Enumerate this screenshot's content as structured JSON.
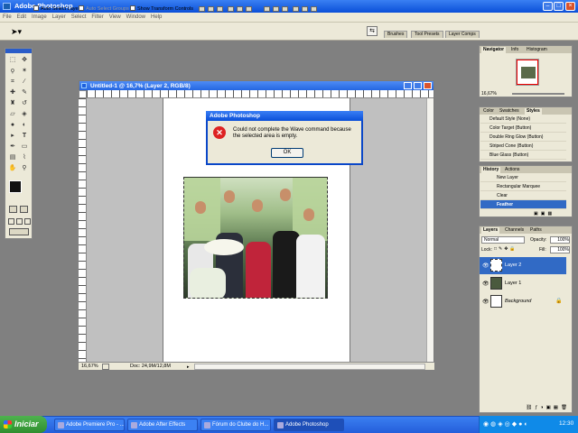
{
  "window": {
    "title": "Adobe Photoshop"
  },
  "menu": [
    "File",
    "Edit",
    "Image",
    "Layer",
    "Select",
    "Filter",
    "View",
    "Window",
    "Help"
  ],
  "options": {
    "auto_select_layer": "Auto Select Layer",
    "auto_select_groups": "Auto Select Groups",
    "show_transform": "Show Transform Controls"
  },
  "palette_well": [
    "Brushes",
    "Tool Presets",
    "Layer Comps"
  ],
  "document": {
    "title": "Untitled-1 @ 16,7% (Layer 2, RGB/8)",
    "zoom": "16,67%",
    "doc_info": "Doc: 24,9M/12,8M"
  },
  "dialog": {
    "title": "Adobe Photoshop",
    "message": "Could not complete the Wave command because the selected area is empty.",
    "ok": "OK"
  },
  "navigator": {
    "tabs": [
      "Navigator",
      "Info",
      "Histogram"
    ],
    "zoom": "16,67%"
  },
  "styles": {
    "tabs": [
      "Color",
      "Swatches",
      "Styles"
    ],
    "items": [
      "Default Style (None)",
      "Color Target (Button)",
      "Double Ring Glow (Button)",
      "Striped Cone (Button)",
      "Blue Glass (Button)"
    ]
  },
  "history": {
    "tabs": [
      "History",
      "Actions"
    ],
    "items": [
      "New Layer",
      "Rectangular Marquee",
      "Clear",
      "Feather"
    ]
  },
  "layers": {
    "tabs": [
      "Layers",
      "Channels",
      "Paths"
    ],
    "blend": "Normal",
    "opacity_label": "Opacity:",
    "opacity": "100%",
    "lock_label": "Lock:",
    "fill_label": "Fill:",
    "fill": "100%",
    "items": [
      "Layer 2",
      "Layer 1",
      "Background"
    ]
  },
  "taskbar": {
    "start": "Iniciar",
    "items": [
      "Adobe Premiere Pro - ...",
      "Adobe After Effects",
      "Fórum do Clube do H...",
      "Adobe Photoshop"
    ],
    "clock": "12:30"
  }
}
